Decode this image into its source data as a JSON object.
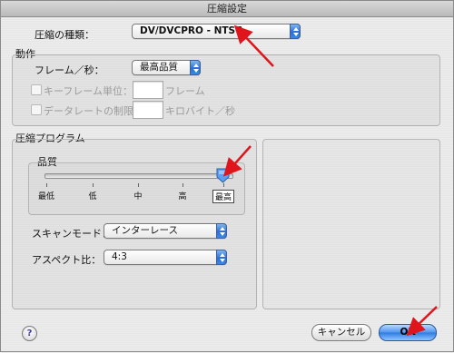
{
  "window": {
    "title": "圧縮設定"
  },
  "compression_type": {
    "label": "圧縮の種類：",
    "value": "DV/DVCPRO - NTSC"
  },
  "motion": {
    "title": "動作",
    "fps_label": "フレーム／秒：",
    "fps_value": "最高品質",
    "keyframe_label": "キーフレーム単位：",
    "keyframe_unit": "フレーム",
    "datarate_label": "データレートの制限：",
    "datarate_unit": "キロバイト／秒"
  },
  "compressor": {
    "title": "圧縮プログラム",
    "quality": {
      "title": "品質",
      "ticks": [
        "最低",
        "低",
        "中",
        "高",
        "最高"
      ],
      "level": 1.0
    },
    "scan_mode": {
      "label": "スキャンモード：",
      "value": "インターレース"
    },
    "aspect": {
      "label": "アスペクト比：",
      "value": "4:3"
    }
  },
  "buttons": {
    "help": "?",
    "cancel": "キャンセル",
    "ok": "OK"
  },
  "colors": {
    "accent": "#2d79e2",
    "annotation_arrow": "#e0141b"
  },
  "icons": [
    "help-icon",
    "popup-arrows-icon",
    "slider-thumb-icon",
    "annotation-arrow-icon"
  ]
}
